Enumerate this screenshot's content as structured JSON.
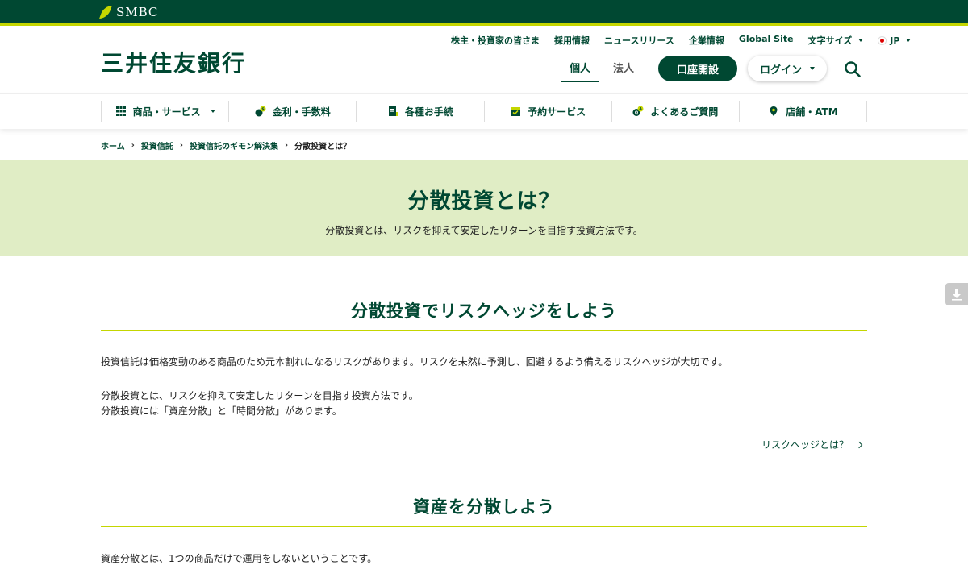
{
  "topbar": {
    "brand": "SMBC"
  },
  "header": {
    "bank_name": "三井住友銀行",
    "util_links": [
      "株主・投資家の皆さま",
      "採用情報",
      "ニュースリリース",
      "企業情報",
      "Global Site"
    ],
    "font_size_label": "文字サイズ",
    "language_label": "JP",
    "segment_tabs": [
      {
        "label": "個人",
        "active": true
      },
      {
        "label": "法人",
        "active": false
      }
    ],
    "open_account_label": "口座開設",
    "login_label": "ログイン"
  },
  "gnav": {
    "items": [
      {
        "label": "商品・サービス",
        "icon": "grid-icon"
      },
      {
        "label": "金利・手数料",
        "icon": "coins-icon"
      },
      {
        "label": "各種お手続",
        "icon": "document-icon"
      },
      {
        "label": "予約サービス",
        "icon": "calendar-icon"
      },
      {
        "label": "よくあるご質問",
        "icon": "qa-icon"
      },
      {
        "label": "店舗・ATM",
        "icon": "map-pin-icon"
      }
    ]
  },
  "breadcrumb": [
    "ホーム",
    "投資信託",
    "投資信託のギモン解決集",
    "分散投資とは？"
  ],
  "hero": {
    "title": "分散投資とは？",
    "lead": "分散投資とは、リスクを抑えて安定したリターンを目指す投資方法です。"
  },
  "section1": {
    "title": "分散投資でリスクヘッジをしよう",
    "para1": "投資信託は価格変動のある商品のため元本割れになるリスクがあります。リスクを未然に予測し、回避するよう備えるリスクヘッジが大切です。",
    "para2_line1": "分散投資とは、リスクを抑えて安定したリターンを目指す投資方法です。",
    "para2_line2": "分散投資には「資産分散」と「時間分散」があります。",
    "link": "リスクヘッジとは？"
  },
  "section2": {
    "title": "資産を分散しよう",
    "para1": "資産分散とは、1つの商品だけで運用をしないということです。"
  },
  "colors": {
    "brand_green": "#004832",
    "accent_lime": "#c4d600",
    "hero_bg": "#e0edc5"
  }
}
